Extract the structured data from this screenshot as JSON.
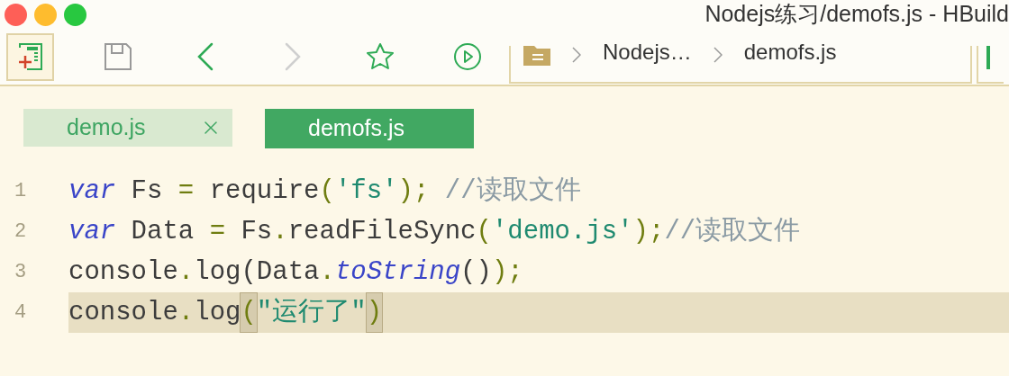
{
  "window": {
    "title": "Nodejs练习/demofs.js - HBuild"
  },
  "toolbar": [
    {
      "kind": "new-file",
      "selected": true,
      "disabled": false
    },
    {
      "kind": "save",
      "selected": false,
      "disabled": false
    },
    {
      "kind": "back",
      "selected": false,
      "disabled": false
    },
    {
      "kind": "forward",
      "selected": false,
      "disabled": true
    },
    {
      "kind": "star",
      "selected": false,
      "disabled": false
    },
    {
      "kind": "run",
      "selected": false,
      "disabled": false
    }
  ],
  "breadcrumb": [
    "Nodejs…",
    "demofs.js"
  ],
  "tabs": [
    {
      "label": "demo.js",
      "selected": false,
      "close_icon": true
    },
    {
      "label": "demofs.js",
      "selected": true,
      "close_icon": false
    }
  ],
  "code": [
    {
      "number": "1",
      "current": false,
      "tokens": [
        {
          "kind": "keyword",
          "text": "var"
        },
        {
          "kind": "plain",
          "text": " Fs "
        },
        {
          "kind": "punct",
          "text": "="
        },
        {
          "kind": "plain",
          "text": " require"
        },
        {
          "kind": "punct",
          "text": "("
        },
        {
          "kind": "string",
          "text": "'fs'"
        },
        {
          "kind": "punct",
          "text": ");"
        },
        {
          "kind": "comment",
          "text": " //读取文件"
        }
      ]
    },
    {
      "number": "2",
      "current": false,
      "tokens": [
        {
          "kind": "keyword",
          "text": "var"
        },
        {
          "kind": "plain",
          "text": " Data "
        },
        {
          "kind": "punct",
          "text": "="
        },
        {
          "kind": "plain",
          "text": " Fs"
        },
        {
          "kind": "punct",
          "text": "."
        },
        {
          "kind": "plain",
          "text": "readFileSync"
        },
        {
          "kind": "punct",
          "text": "("
        },
        {
          "kind": "string",
          "text": "'demo.js'"
        },
        {
          "kind": "punct",
          "text": ");"
        },
        {
          "kind": "comment",
          "text": "//读取文件"
        }
      ]
    },
    {
      "number": "3",
      "current": false,
      "tokens": [
        {
          "kind": "plain",
          "text": "console"
        },
        {
          "kind": "punct",
          "text": "."
        },
        {
          "kind": "plain",
          "text": "log(Data"
        },
        {
          "kind": "punct",
          "text": "."
        },
        {
          "kind": "method",
          "text": "toString"
        },
        {
          "kind": "plain",
          "text": "()"
        },
        {
          "kind": "punct",
          "text": ");"
        }
      ]
    },
    {
      "number": "4",
      "current": true,
      "tokens": [
        {
          "kind": "plain",
          "text": "console"
        },
        {
          "kind": "punct",
          "text": "."
        },
        {
          "kind": "plain",
          "text": "log"
        },
        {
          "kind": "match",
          "text": "("
        },
        {
          "kind": "string",
          "text": "\"运行了\""
        },
        {
          "kind": "match",
          "text": ")"
        }
      ]
    }
  ]
}
